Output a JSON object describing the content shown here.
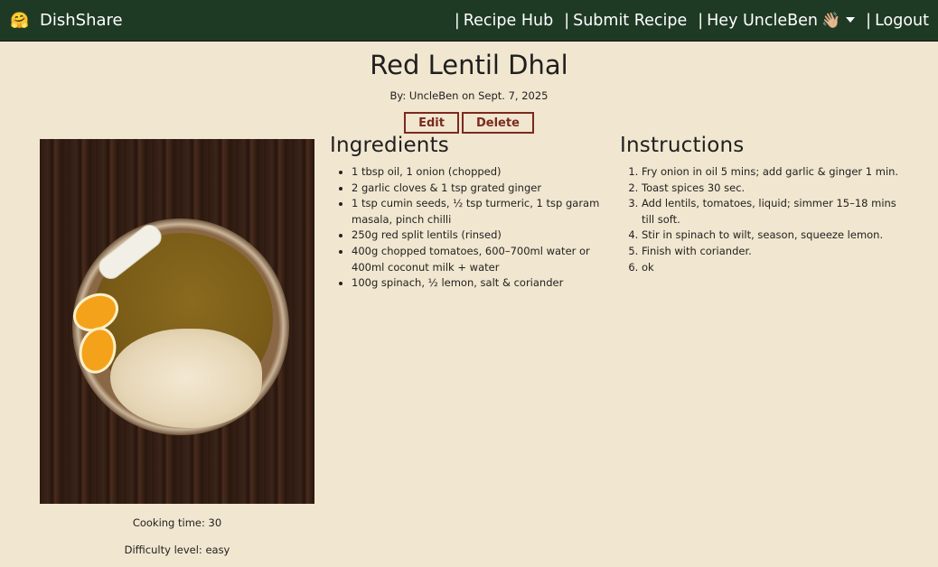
{
  "nav": {
    "brand": "DishShare",
    "brand_icon": "🤗",
    "links": {
      "recipe_hub": "Recipe Hub",
      "submit_recipe": "Submit Recipe",
      "user_greeting": "Hey UncleBen",
      "user_emoji": "👋🏼",
      "logout": "Logout"
    },
    "separator": "|"
  },
  "recipe": {
    "title": "Red Lentil Dhal",
    "byline": "By: UncleBen on Sept. 7, 2025",
    "edit_label": "Edit",
    "delete_label": "Delete",
    "cooking_time": "Cooking time: 30",
    "difficulty": "Difficulty level: easy",
    "ingredients_heading": "Ingredients",
    "ingredients": [
      "1 tbsp oil, 1 onion (chopped)",
      "2 garlic cloves & 1 tsp grated ginger",
      "1 tsp cumin seeds, ½ tsp turmeric, 1 tsp garam masala, pinch chilli",
      "250g red split lentils (rinsed)",
      "400g chopped tomatoes, 600–700ml water or 400ml coconut milk + water",
      "100g spinach, ½ lemon, salt & coriander"
    ],
    "instructions_heading": "Instructions",
    "instructions": [
      "Fry onion in oil 5 mins; add garlic & ginger 1 min.",
      "Toast spices 30 sec.",
      "Add lentils, tomatoes, liquid; simmer 15–18 mins till soft.",
      "Stir in spinach to wilt, season, squeeze lemon.",
      "Finish with coriander.",
      "ok"
    ]
  },
  "colors": {
    "navbar": "#1f3a24",
    "background": "#f1e6cf",
    "accent": "#7a2a1f"
  }
}
